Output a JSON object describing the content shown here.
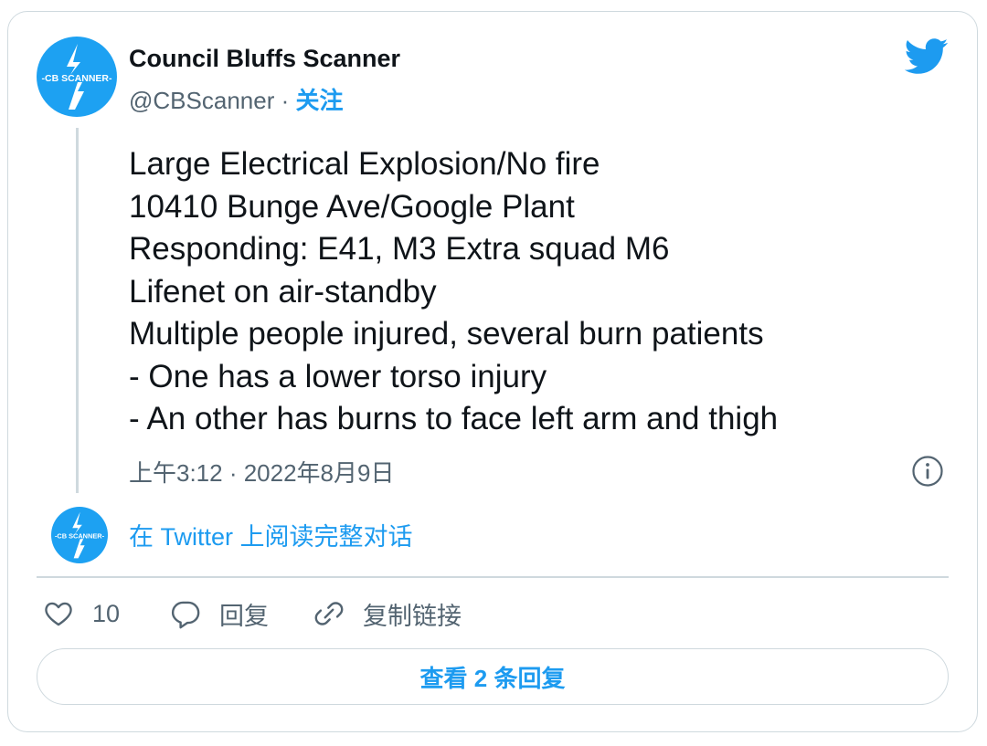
{
  "author": {
    "display_name": "Council Bluffs Scanner",
    "handle": "@CBScanner",
    "separator": "·",
    "follow_label": "关注",
    "avatar_text": "-CB SCANNER-"
  },
  "tweet": {
    "lines": [
      "Large Electrical Explosion/No fire",
      "10410 Bunge Ave/Google Plant",
      "Responding: E41, M3 Extra squad M6",
      "Lifenet on air-standby",
      "Multiple people injured, several burn patients",
      "- One has a lower torso injury",
      "- An other has burns to face left arm and thigh"
    ],
    "timestamp": "上午3:12 · 2022年8月9日"
  },
  "conversation_link": "在 Twitter 上阅读完整对话",
  "actions": {
    "like_count": "10",
    "reply_label": "回复",
    "copy_link_label": "复制链接"
  },
  "view_replies_label": "查看 2 条回复",
  "colors": {
    "accent": "#1d9bf0",
    "avatar_bg": "#1da1f2",
    "text_primary": "#0f1419",
    "text_secondary": "#536471",
    "border": "#cfd9de"
  },
  "icons": [
    "twitter-bird-icon",
    "info-icon",
    "heart-icon",
    "reply-bubble-icon",
    "link-icon",
    "lightning-bolt-icon"
  ]
}
